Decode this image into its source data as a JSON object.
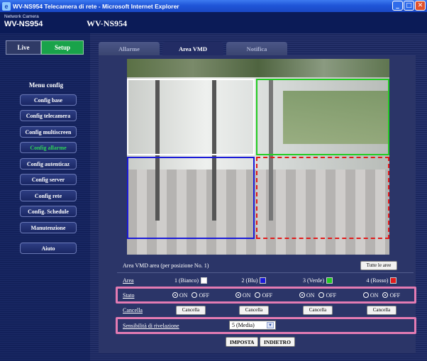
{
  "window": {
    "title": "WV-NS954 Telecamera di rete - Microsoft Internet Explorer",
    "buttons": {
      "minimize": "_",
      "maximize": "□",
      "close": "✕"
    }
  },
  "header": {
    "brand_small": "Network Camera",
    "brand_big": "WV-NS954",
    "model": "WV-NS954"
  },
  "mode": {
    "live": "Live",
    "setup": "Setup"
  },
  "menu": {
    "title": "Menu config",
    "items": [
      "Config base",
      "Config telecamera",
      "Config multiscreen",
      "Config allarme",
      "Config autenticaz",
      "Config server",
      "Config rete",
      "Config. Schedule",
      "Manutenzione"
    ],
    "help": "Aiuto"
  },
  "tabs": [
    "Allarme",
    "Area VMD",
    "Notifica"
  ],
  "vmd": {
    "caption": "Area VMD area (per posizione No. 1)",
    "all_areas_button": "Tutte le aree",
    "area_label": "Area",
    "areas": [
      "1 (Bianco)",
      "2 (Blu)",
      "3 (Verde)",
      "4 (Rosso)"
    ],
    "area_colors": [
      "#ffffff",
      "#1a1ad8",
      "#22cc22",
      "#e21b1b"
    ],
    "stato_label": "Stato",
    "on_label": "ON",
    "off_label": "OFF",
    "cancella_label": "Cancella",
    "cancella_button": "Cancella",
    "sens_label": "Sensibilità di rivelazione",
    "sens_value": "5 (Media)",
    "imposta_button": "IMPOSTA",
    "indietro_button": "INDIETRO"
  }
}
